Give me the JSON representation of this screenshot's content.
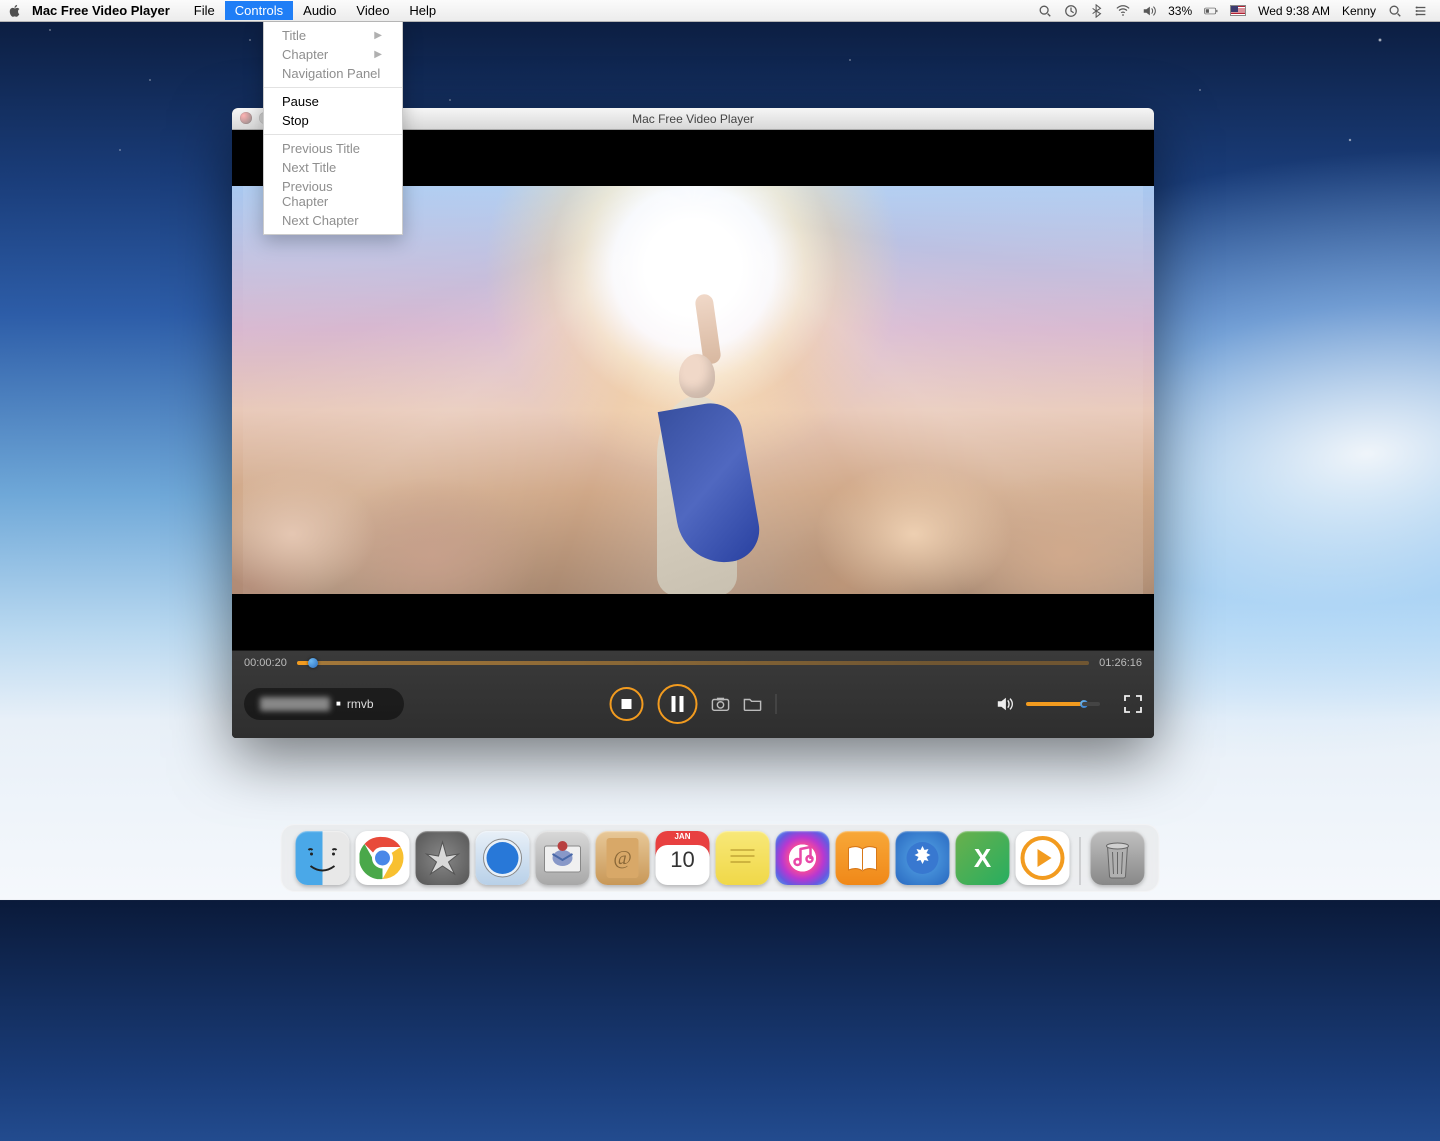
{
  "menubar": {
    "app_name": "Mac Free Video Player",
    "menus": [
      "File",
      "Controls",
      "Audio",
      "Video",
      "Help"
    ],
    "active_menu": "Controls",
    "status": {
      "battery": "33%",
      "datetime": "Wed 9:38 AM",
      "user": "Kenny"
    }
  },
  "dropdown": {
    "items": [
      {
        "label": "Title",
        "enabled": false,
        "submenu": true
      },
      {
        "label": "Chapter",
        "enabled": false,
        "submenu": true
      },
      {
        "label": "Navigation Panel",
        "enabled": false,
        "submenu": false
      },
      {
        "sep": true
      },
      {
        "label": "Pause",
        "enabled": true
      },
      {
        "label": "Stop",
        "enabled": true
      },
      {
        "sep": true
      },
      {
        "label": "Previous Title",
        "enabled": false
      },
      {
        "label": "Next Title",
        "enabled": false
      },
      {
        "label": "Previous Chapter",
        "enabled": false
      },
      {
        "label": "Next Chapter",
        "enabled": false
      }
    ]
  },
  "player": {
    "window_title": "Mac Free Video Player",
    "current_time": "00:00:20",
    "total_time": "01:26:16",
    "file_ext": "rmvb"
  },
  "dock": {
    "calendar": {
      "month": "JAN",
      "day": "10"
    },
    "green_label": "X"
  }
}
